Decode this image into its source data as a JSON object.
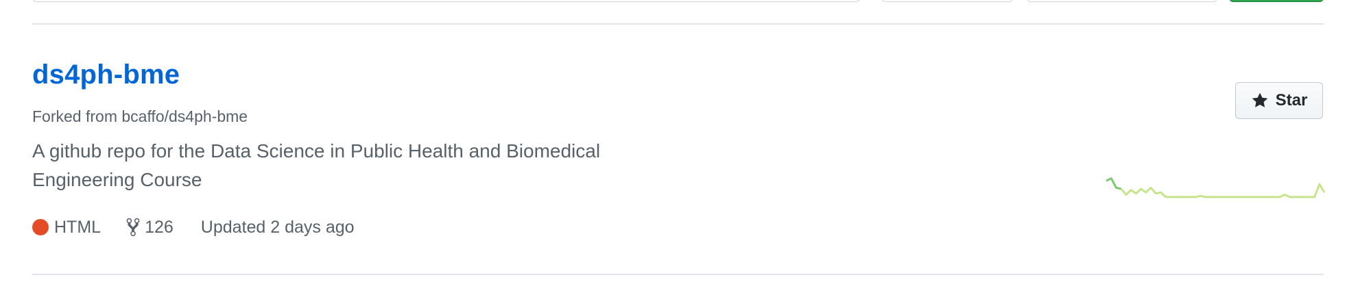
{
  "repo": {
    "name": "ds4ph-bme",
    "forked_prefix": "Forked from ",
    "forked_from": "bcaffo/ds4ph-bme",
    "description": "A github repo for the Data Science in Public Health and Biomedical Engineering Course",
    "language": "HTML",
    "language_color": "#e34c26",
    "forks": "126",
    "updated": "Updated 2 days ago"
  },
  "star_button": {
    "label": "Star",
    "icon": "star-icon"
  },
  "activity_graph": {
    "description": "commit activity sparkline",
    "values": [
      0.85,
      0.95,
      0.55,
      0.5,
      0.25,
      0.45,
      0.3,
      0.5,
      0.35,
      0.55,
      0.3,
      0.35,
      0.15,
      0.15,
      0.15,
      0.15,
      0.15,
      0.15,
      0.15,
      0.2,
      0.15,
      0.15,
      0.15,
      0.15,
      0.15,
      0.15,
      0.15,
      0.15,
      0.15,
      0.15,
      0.15,
      0.15,
      0.15,
      0.15,
      0.15,
      0.15,
      0.25,
      0.15,
      0.15,
      0.15,
      0.15,
      0.15,
      0.15,
      0.7,
      0.35
    ],
    "color_recent": "#c6e48b",
    "color_early": "#7bc96f"
  }
}
